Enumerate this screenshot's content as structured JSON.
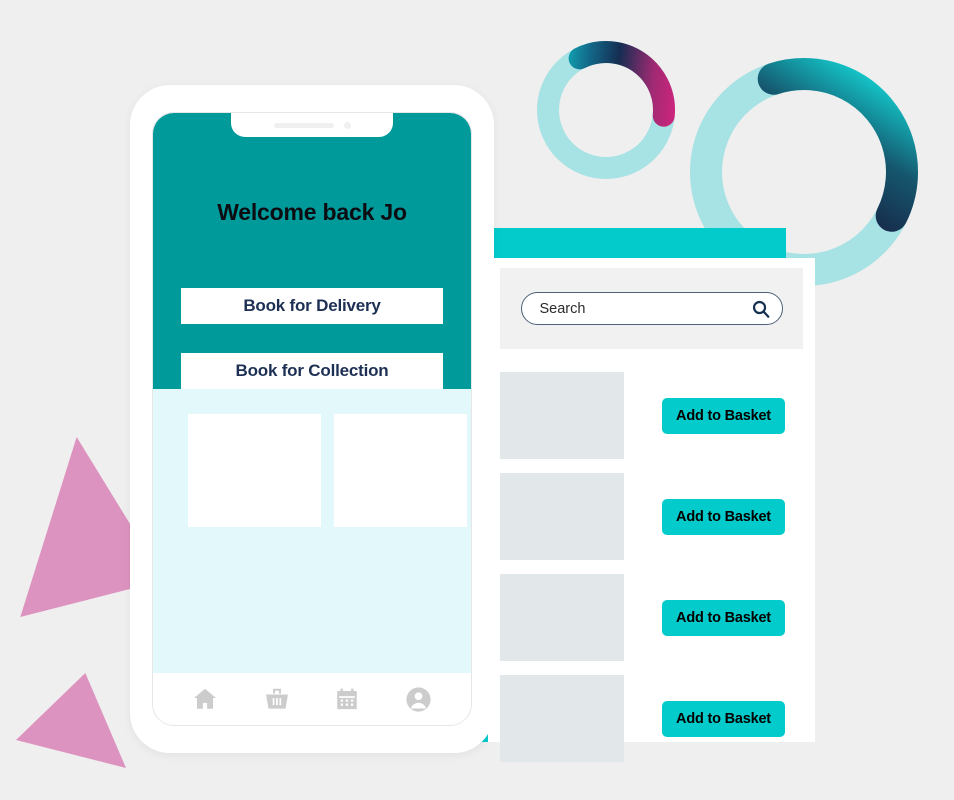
{
  "theme": {
    "teal": "#019a9a",
    "cyan": "#03cbcb",
    "cyan_edge": "#05b3b6",
    "pale_cyan": "#e2f8fa",
    "navy_text": "#1d3054",
    "pink": "#dd93bf",
    "ring_track": "#a7e2e4",
    "placeholder_gray": "#e2e7ea",
    "page_bg": "#efefef",
    "magenta": "#d12b82",
    "deep_navy": "#16304f"
  },
  "mobile_app": {
    "notch": {
      "speaker": "speaker-bar",
      "camera": "camera-dot"
    },
    "hero": {
      "greeting": "Welcome back Jo",
      "buttons": [
        {
          "label": "Book for Delivery",
          "name": "book-for-delivery-button"
        },
        {
          "label": "Book for Collection",
          "name": "book-for-collection-button"
        }
      ]
    },
    "content_cards": [
      {
        "name": "content-card-1"
      },
      {
        "name": "content-card-2"
      }
    ],
    "bottom_nav": [
      {
        "icon": "home-icon",
        "name": "nav-home"
      },
      {
        "icon": "basket-icon",
        "name": "nav-basket"
      },
      {
        "icon": "calendar-icon",
        "name": "nav-calendar"
      },
      {
        "icon": "account-icon",
        "name": "nav-account"
      }
    ]
  },
  "desktop_panel": {
    "search": {
      "placeholder": "Search",
      "value": "",
      "icon": "search-icon"
    },
    "products": [
      {
        "thumb": "product-image-placeholder",
        "button_label": "Add to Basket"
      },
      {
        "thumb": "product-image-placeholder",
        "button_label": "Add to Basket"
      },
      {
        "thumb": "product-image-placeholder",
        "button_label": "Add to Basket"
      },
      {
        "thumb": "product-image-placeholder",
        "button_label": "Add to Basket"
      }
    ]
  },
  "decorations": [
    {
      "name": "donut-ring-small",
      "type": "ring"
    },
    {
      "name": "donut-ring-large",
      "type": "ring"
    },
    {
      "name": "pink-quadrilateral",
      "type": "polygon"
    },
    {
      "name": "pink-triangle",
      "type": "polygon"
    }
  ]
}
